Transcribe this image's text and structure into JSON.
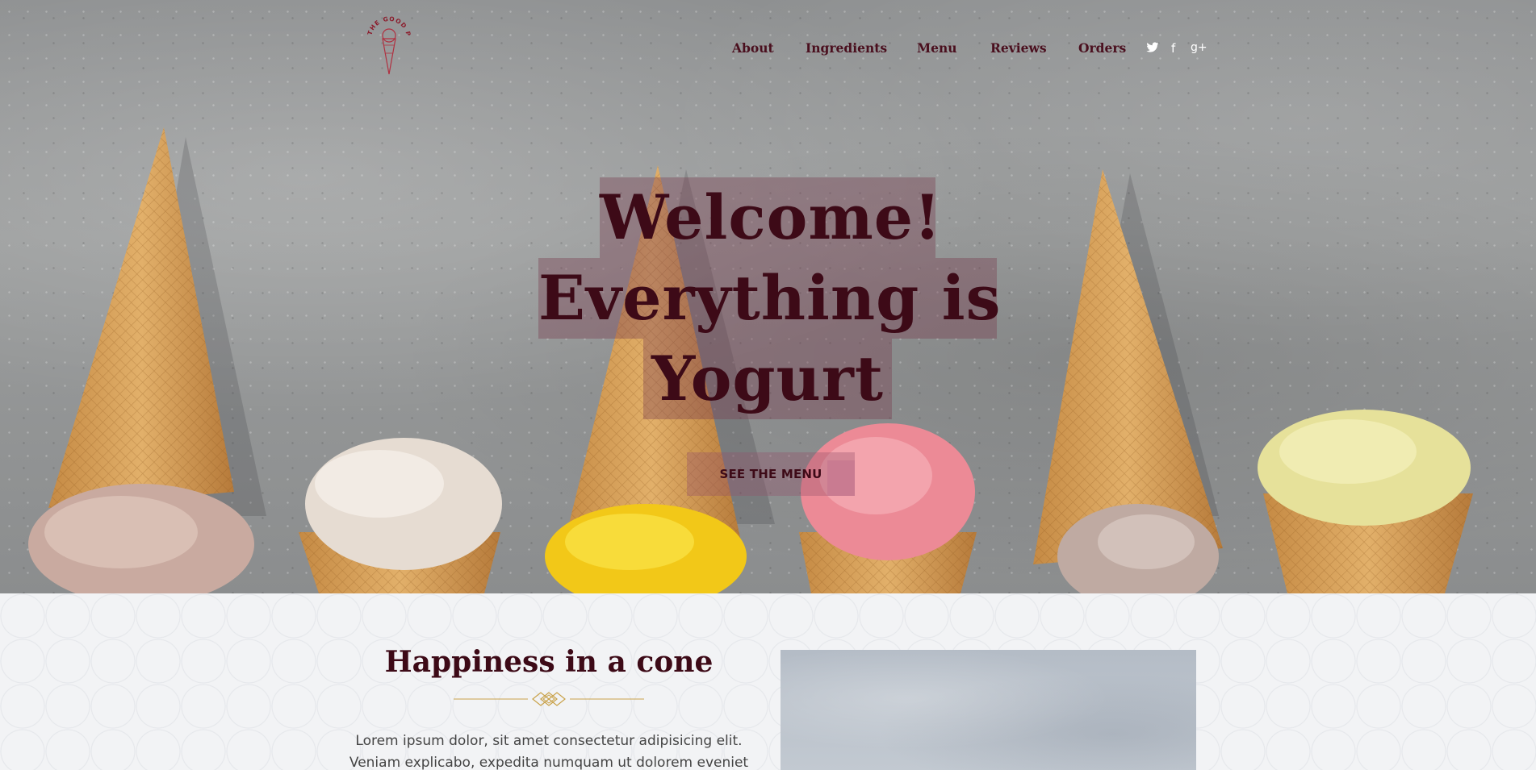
{
  "brand": {
    "logo_text": "THE GOOD PLACE"
  },
  "nav": {
    "items": [
      {
        "label": "About"
      },
      {
        "label": "Ingredients"
      },
      {
        "label": "Menu"
      },
      {
        "label": "Reviews"
      },
      {
        "label": "Orders"
      }
    ],
    "social": [
      {
        "icon": "twitter-icon"
      },
      {
        "icon": "facebook-icon",
        "glyph": "f"
      },
      {
        "icon": "google-plus-icon",
        "glyph": "g+"
      }
    ]
  },
  "hero": {
    "headline_lines": [
      "Welcome!",
      "Everything is",
      "Yogurt"
    ],
    "cta_label": "SEE THE MENU"
  },
  "section": {
    "title": "Happiness in a cone",
    "paragraph": "Lorem ipsum dolor, sit amet consectetur adipisicing elit. Veniam explicabo, expedita numquam ut dolorem eveniet esse animi"
  },
  "colors": {
    "brand_maroon": "#3d0a17",
    "highlight": "#8a4a5e",
    "gold": "#c9a24a"
  }
}
